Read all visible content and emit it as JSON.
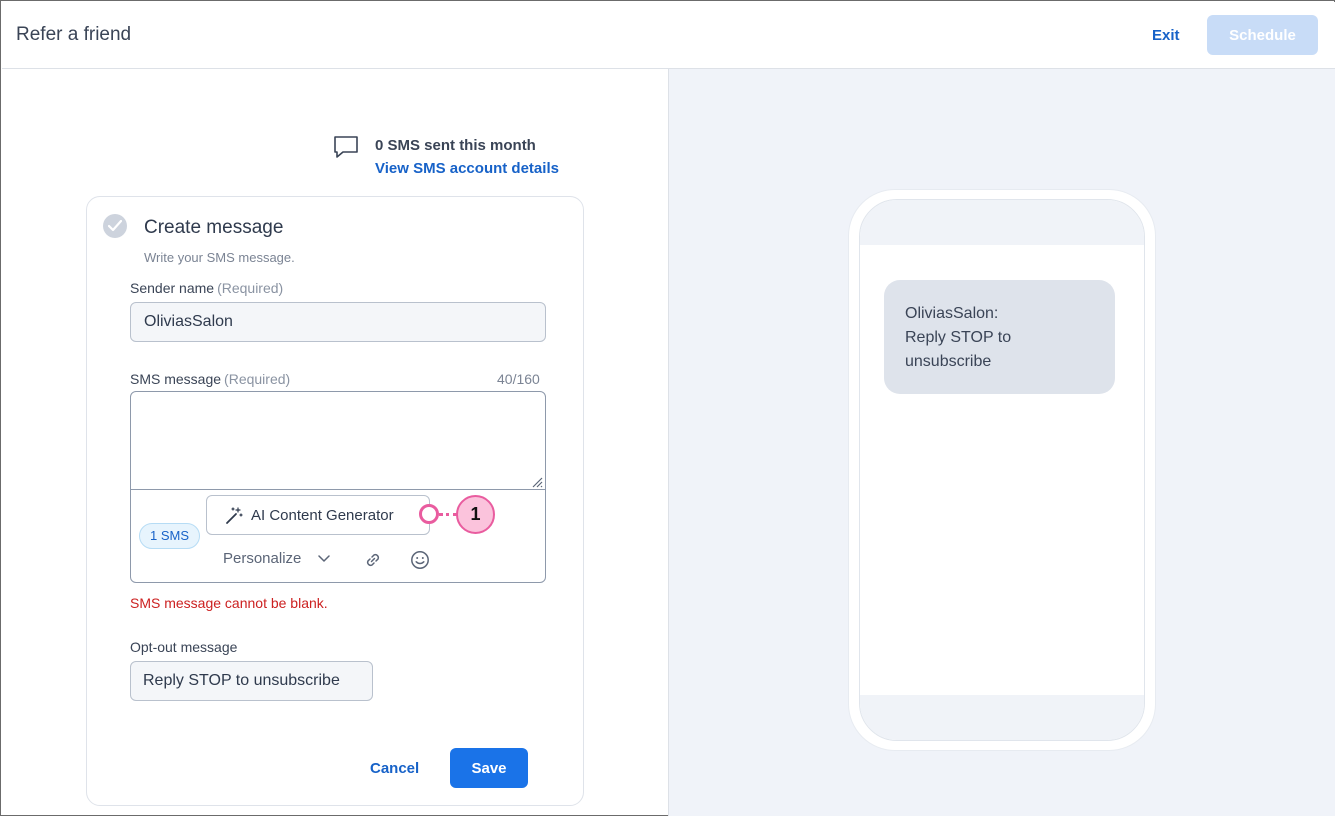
{
  "header": {
    "title": "Refer a friend",
    "exit_label": "Exit",
    "schedule_label": "Schedule"
  },
  "sms_stats": {
    "sent_text": "0 SMS sent this month",
    "account_link": "View SMS account details"
  },
  "card": {
    "title": "Create message",
    "subtitle": "Write your SMS message.",
    "sender": {
      "label": "Sender name",
      "required": "(Required)",
      "value": "OliviasSalon"
    },
    "sms": {
      "label": "SMS message",
      "required": "(Required)",
      "counter": "40/160",
      "value": "",
      "badge": "1 SMS",
      "ai_button": "AI Content Generator",
      "personalize": "Personalize",
      "error": "SMS message cannot be blank."
    },
    "optout": {
      "label": "Opt-out message",
      "value": "Reply STOP to unsubscribe"
    },
    "cancel_label": "Cancel",
    "save_label": "Save"
  },
  "callout": {
    "number": "1"
  },
  "preview": {
    "message": "OliviasSalon:\nReply STOP to\nunsubscribe"
  },
  "colors": {
    "accent": "#1a73e8",
    "link": "#1762c8",
    "error": "#cc2121",
    "callout": "#e95c9f",
    "preview_bg": "#f0f3f9"
  },
  "icons": [
    "chat-bubble-icon",
    "check-circle-icon",
    "magic-wand-icon",
    "chevron-down-icon",
    "link-icon",
    "emoji-icon",
    "resize-handle-icon"
  ]
}
